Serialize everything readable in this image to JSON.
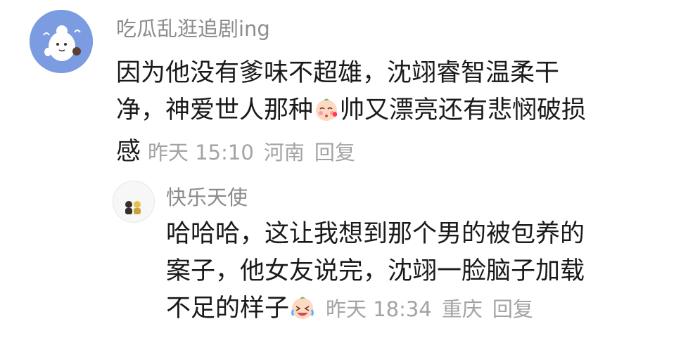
{
  "comment": {
    "username": "吃瓜乱逛追剧ing",
    "lines": [
      "因为他没有爹味不超雄，沈翊睿智温柔干",
      "净，神爱世人那种",
      "帅又漂亮还有悲悯破损",
      "感"
    ],
    "emoji_icon": "kiss-blush-emoji-icon",
    "time": "昨天 15:10",
    "location": "河南",
    "reply_label": "回复",
    "avatar_color": "#7b9ce0"
  },
  "reply": {
    "username": "快乐天使",
    "lines": [
      "哈哈哈，这让我想到那个男的被包养的",
      "案子，他女友说完，沈翊一脸脑子加载",
      "不足的样子"
    ],
    "emoji_icon": "laugh-cry-emoji-icon",
    "time": "昨天 18:34",
    "location": "重庆",
    "reply_label": "回复"
  }
}
